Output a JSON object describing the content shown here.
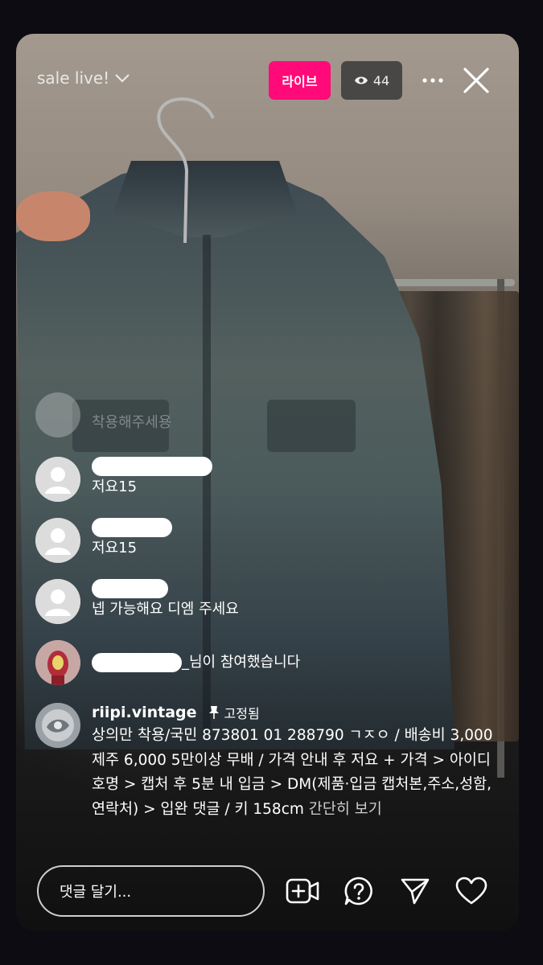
{
  "header": {
    "title": "sale live!",
    "live_badge": "라이브",
    "viewer_count": "44",
    "colors": {
      "live_badge_bg": "#ff0a78",
      "viewer_badge_bg": "#3c3c3c"
    }
  },
  "comments": [
    {
      "username": "",
      "text": "착용해주세용",
      "faded": true
    },
    {
      "username": "",
      "text": "저요15"
    },
    {
      "username": "",
      "text": "저요15"
    },
    {
      "username": "",
      "text": "넵 가능해요 디엠 주세요"
    }
  ],
  "join_notice": {
    "text": "_님이 참여했습니다"
  },
  "pinned": {
    "username": "riipi.vintage",
    "pin_label": "고정됨",
    "text": "상의만 착용/국민 873801 01 288790 ㄱㅈㅇ / 배송비 3,000 제주 6,000 5만이상 무배 / 가격 안내 후 저요 + 가격 > 아이디 호명 > 캡처 후 5분 내 입금 > DM(제품·입금 캡처본,주소,성함,연락처) > 입완 댓글 / 키 158cm",
    "more_label": "간단히 보기"
  },
  "bottom_bar": {
    "placeholder": "댓글 달기...",
    "icons": [
      "add-video-guest-icon",
      "question-icon",
      "send-icon",
      "heart-icon"
    ]
  }
}
